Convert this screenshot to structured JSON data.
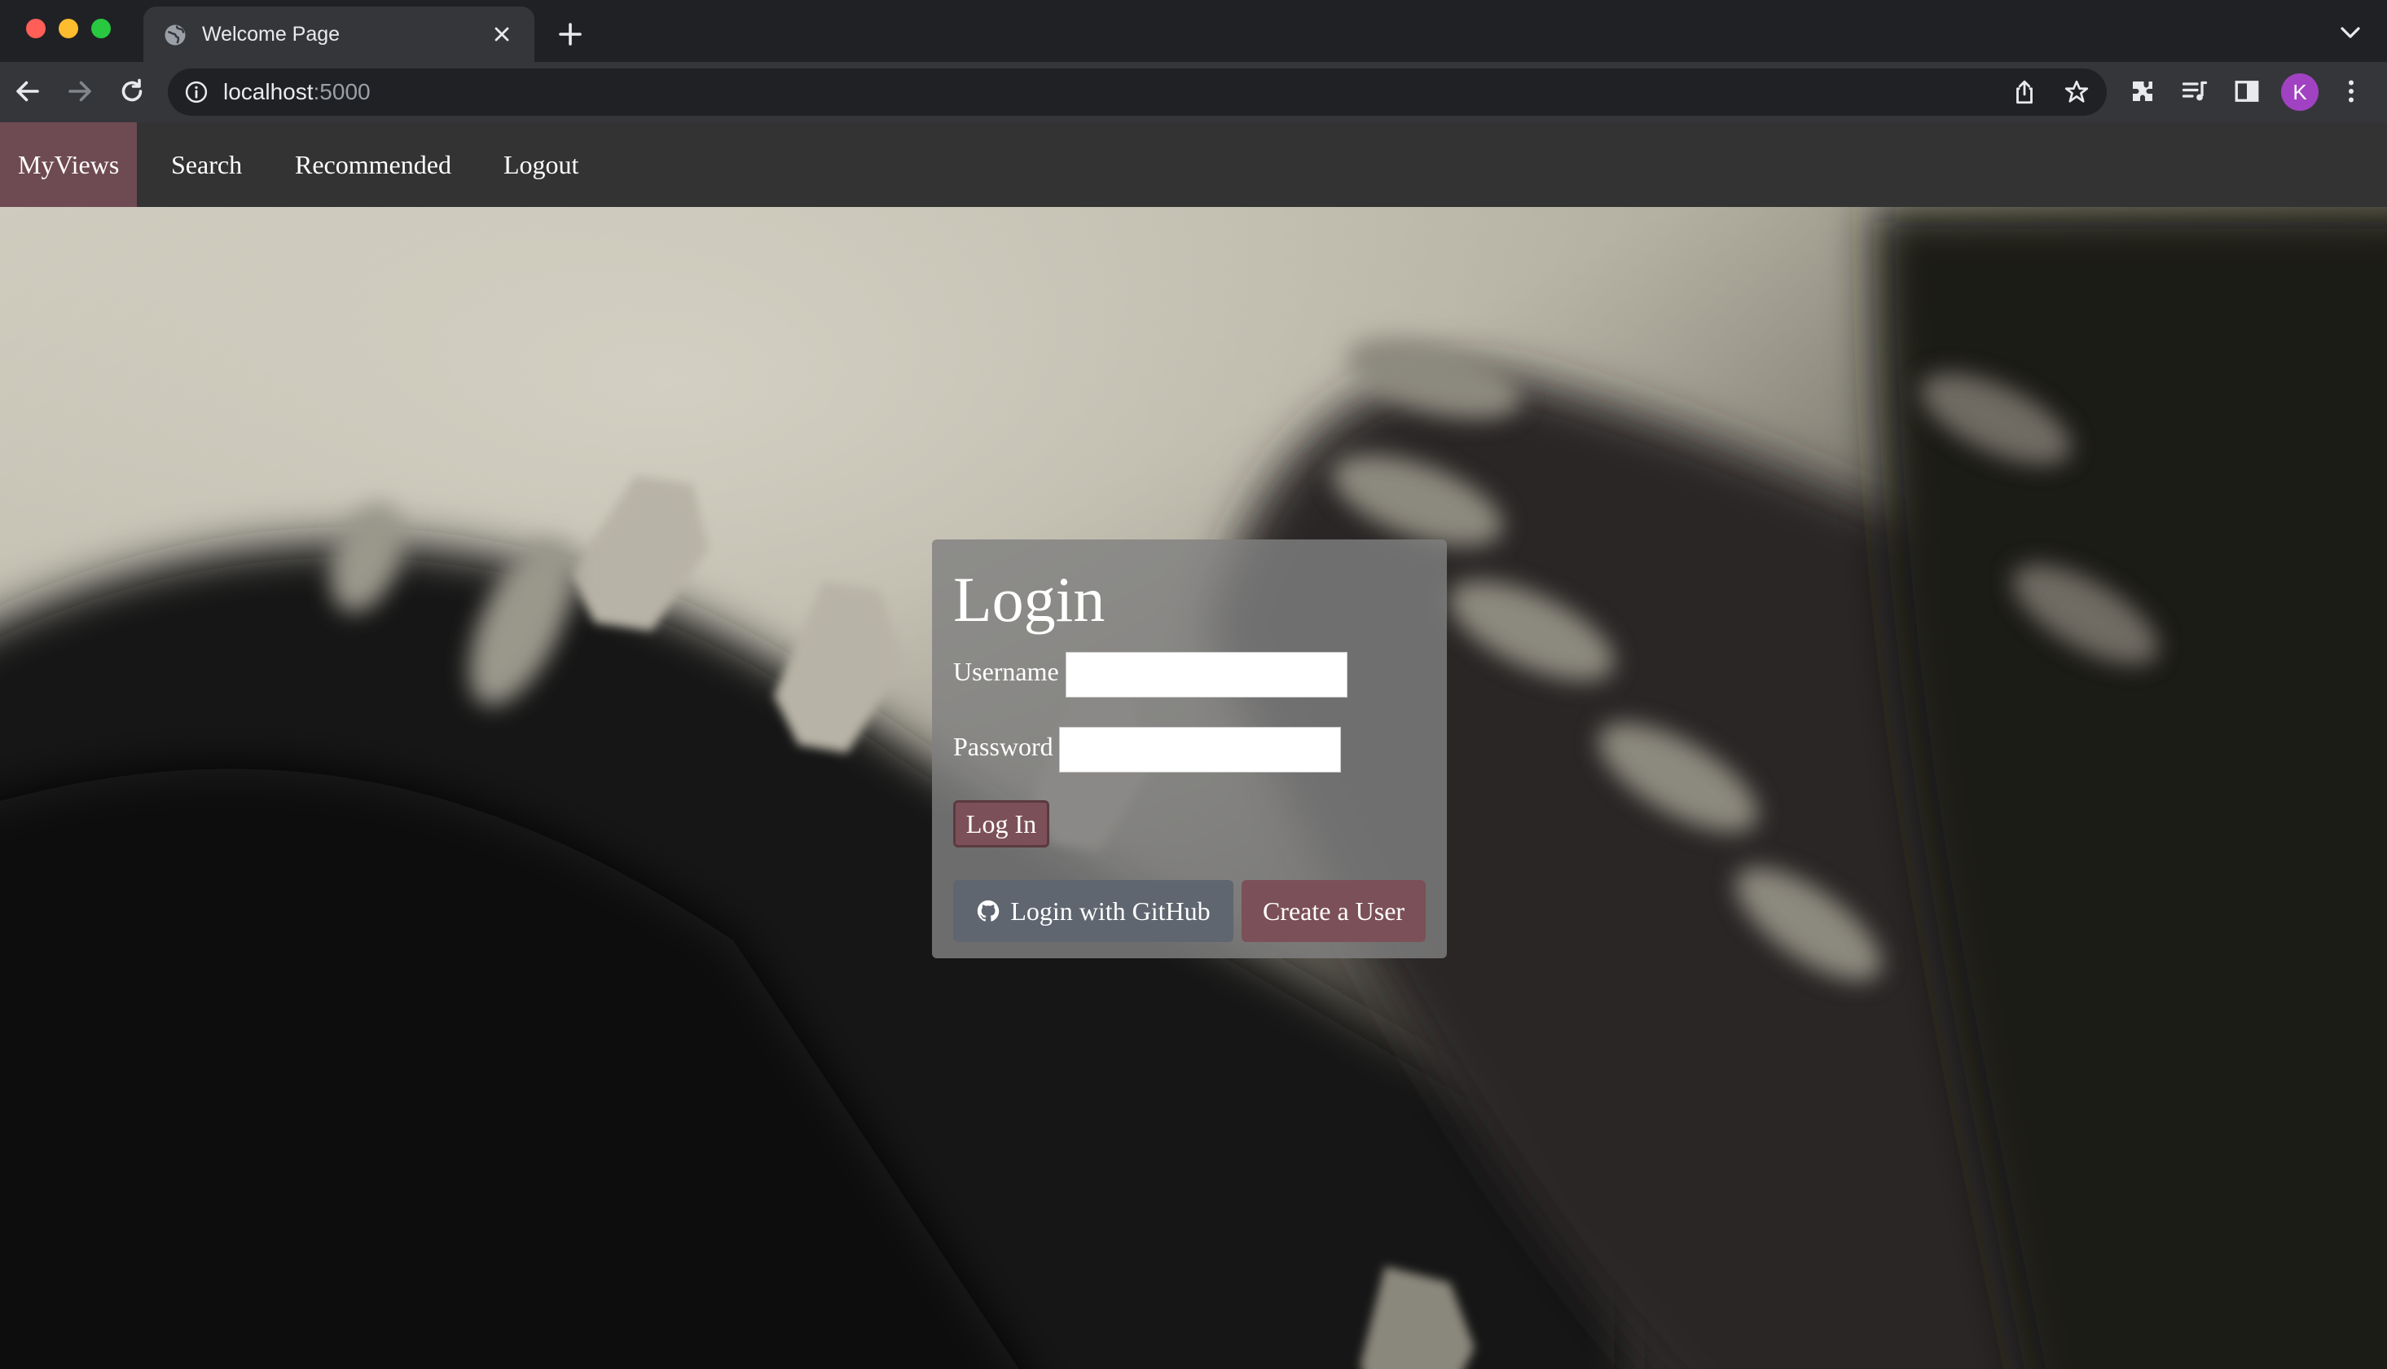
{
  "browser": {
    "tab_title": "Welcome Page",
    "url_host": "localhost",
    "url_port": ":5000",
    "profile_initial": "K"
  },
  "nav": {
    "items": [
      {
        "label": "MyViews",
        "active": true
      },
      {
        "label": "Search"
      },
      {
        "label": "Recommended"
      },
      {
        "label": "Logout"
      }
    ]
  },
  "login": {
    "title": "Login",
    "username_label": "Username",
    "username_value": "",
    "password_label": "Password",
    "password_value": "",
    "login_button": "Log In",
    "github_button": "Login with GitHub",
    "create_button": "Create a User"
  },
  "colors": {
    "navbar_bg": "#333333",
    "nav_active_bg": "#6e4a52",
    "accent_button": "#7c5058",
    "github_button": "#5f6670",
    "avatar": "#a142c2"
  },
  "icons": [
    "globe-icon",
    "close-icon",
    "plus-icon",
    "chevron-down-icon",
    "back-arrow-icon",
    "forward-arrow-icon",
    "reload-icon",
    "info-icon",
    "share-icon",
    "star-icon",
    "extensions-icon",
    "media-queue-icon",
    "side-panel-icon",
    "kebab-menu-icon",
    "github-icon"
  ]
}
